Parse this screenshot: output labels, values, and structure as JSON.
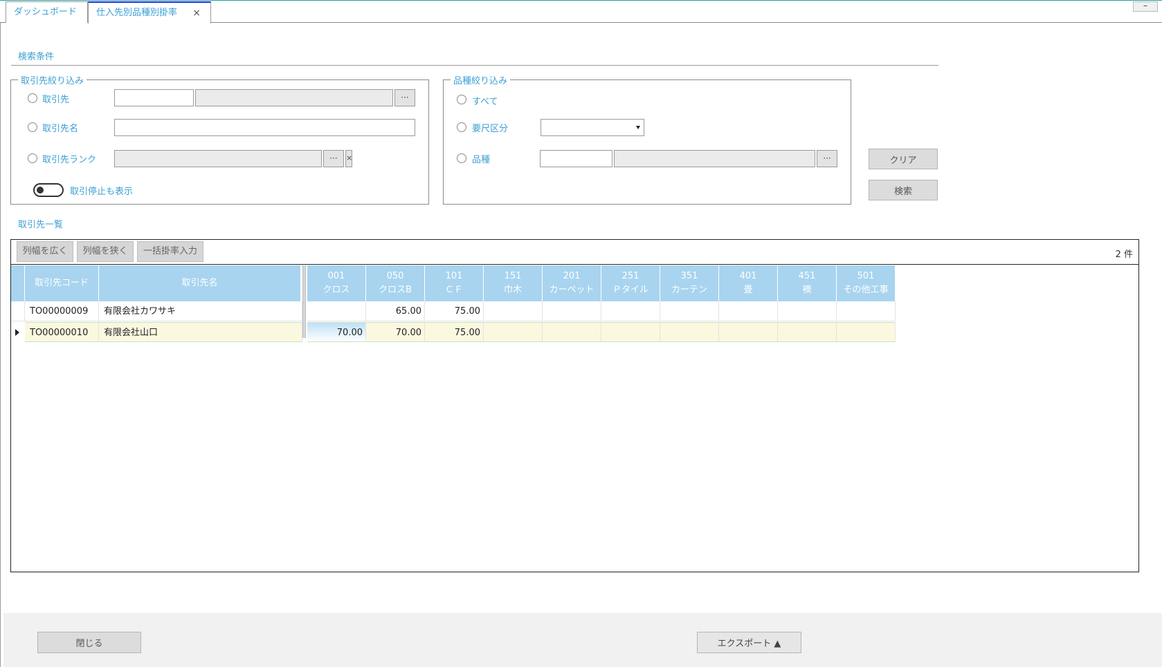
{
  "tabs": [
    {
      "label": "ダッシュボード"
    },
    {
      "label": "仕入先別品種別掛率",
      "close": "×"
    }
  ],
  "window": {
    "minimize": "–"
  },
  "search": {
    "section_title": "検索条件",
    "supplier_group": {
      "legend": "取引先絞り込み",
      "opt_supplier": "取引先",
      "opt_supplier_name": "取引先名",
      "opt_supplier_rank": "取引先ランク",
      "ellipsis": "···",
      "clear_x": "×",
      "show_stopped": "取引停止も表示"
    },
    "product_group": {
      "legend": "品種絞り込み",
      "opt_all": "すべて",
      "opt_measure": "要尺区分",
      "opt_product": "品種",
      "ellipsis": "···"
    },
    "clear_button": "クリア",
    "search_button": "検索"
  },
  "list": {
    "title": "取引先一覧",
    "toolbar": {
      "widen": "列幅を広く",
      "narrow": "列幅を狭く",
      "bulk": "一括掛率入力"
    },
    "count": "2 件",
    "columns": {
      "code": "取引先コード",
      "name": "取引先名",
      "products": [
        {
          "code": "001",
          "name": "クロス"
        },
        {
          "code": "050",
          "name": "クロスB"
        },
        {
          "code": "101",
          "name": "ＣＦ"
        },
        {
          "code": "151",
          "name": "巾木"
        },
        {
          "code": "201",
          "name": "カーペット"
        },
        {
          "code": "251",
          "name": "Ｐタイル"
        },
        {
          "code": "351",
          "name": "カーテン"
        },
        {
          "code": "401",
          "name": "畳"
        },
        {
          "code": "451",
          "name": "襖"
        },
        {
          "code": "501",
          "name": "その他工事"
        }
      ]
    },
    "rows": [
      {
        "code": "TO00000009",
        "name": "有限会社カワサキ",
        "rates": [
          "",
          "65.00",
          "75.00",
          "",
          "",
          "",
          "",
          "",
          "",
          ""
        ]
      },
      {
        "code": "TO00000010",
        "name": "有限会社山口",
        "rates": [
          "70.00",
          "70.00",
          "75.00",
          "",
          "",
          "",
          "",
          "",
          "",
          ""
        ]
      }
    ]
  },
  "footer": {
    "close": "閉じる",
    "export": "エクスポート ▲"
  }
}
